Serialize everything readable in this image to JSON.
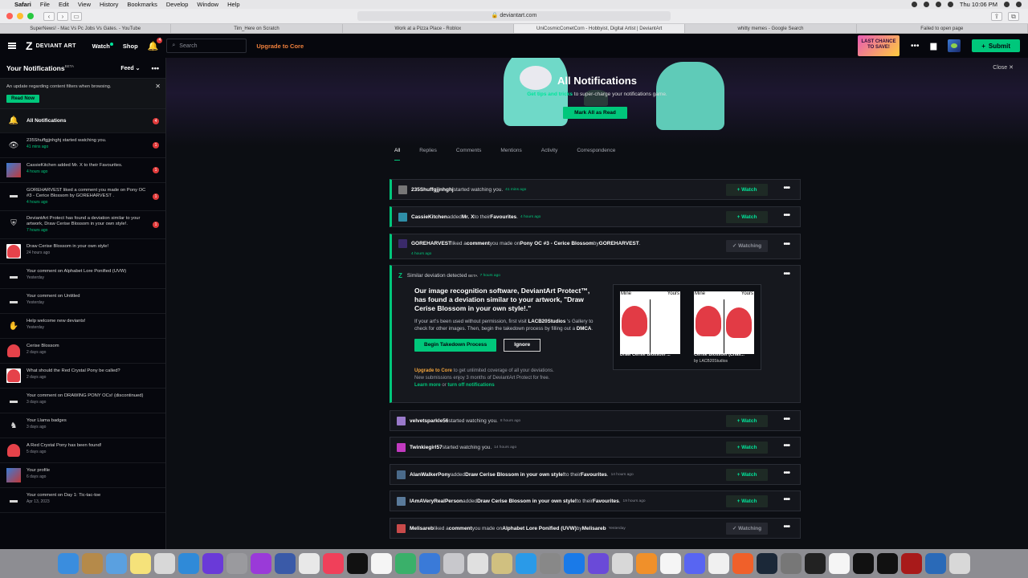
{
  "menubar": {
    "app": "Safari",
    "items": [
      "File",
      "Edit",
      "View",
      "History",
      "Bookmarks",
      "Develop",
      "Window",
      "Help"
    ],
    "clock": "Thu 10:06 PM"
  },
  "browser": {
    "url": "deviantart.com",
    "tabs": [
      "SuperNews! - Mac Vs Pc Jobs Vs Gates. - YouTube",
      "Tim_Here on Scratch",
      "Work at a Pizza Place - Roblox",
      "UniCosmicCometCorn - Hobbyist, Digital Artist | DeviantArt",
      "whitty memes - Google Search",
      "Failed to open page"
    ]
  },
  "header": {
    "logo": "DEVIANT ART",
    "watch": "Watch",
    "shop": "Shop",
    "bell_badge": "4",
    "search_placeholder": "Search",
    "upgrade": "Upgrade to Core",
    "promo": "LAST CHANCE TO SAVE!",
    "submit": "Submit"
  },
  "sidebar": {
    "title": "Your Notifications",
    "title_sup": "BETA",
    "feed": "Feed",
    "notice": "An update regarding content filters when browsing.",
    "notice_btn": "Read Now",
    "all_label": "All Notifications",
    "all_badge": "4",
    "items": [
      {
        "text": "235Shuffgjjnhghj started watching you.",
        "time": "41 mins ago",
        "badge": "1",
        "icon": "eye-icon",
        "green": true
      },
      {
        "text": "CassieKitchen added Mr. X to their Favourites.",
        "time": "4 hours ago",
        "badge": "1",
        "icon": "avatar",
        "green": true
      },
      {
        "text": "GOREHARVEST liked a comment you made on Pony OC #3 - Cerice Blossom by GOREHARVEST .",
        "time": "4 hours ago",
        "badge": "1",
        "icon": "comment-icon",
        "green": true
      },
      {
        "text": "DeviantArt Protect has found a deviation similar to your artwork, Draw Cerise Blossom in your own style!.",
        "time": "7 hours ago",
        "badge": "1",
        "icon": "shield-icon",
        "green": true
      },
      {
        "text": "Draw Cerise Blossom in your own style!",
        "time": "24 hours ago",
        "badge": "",
        "icon": "thumb",
        "green": false
      },
      {
        "text": "Your comment on Alphabet Lore Ponified (UVW)",
        "time": "Yesterday",
        "badge": "",
        "icon": "comment-icon",
        "green": false
      },
      {
        "text": "Your comment on Untitled",
        "time": "Yesterday",
        "badge": "",
        "icon": "comment-icon",
        "green": false
      },
      {
        "text": "Help welcome new deviants!",
        "time": "Yesterday",
        "badge": "",
        "icon": "wave-icon",
        "green": false
      },
      {
        "text": "Cerise Blossom",
        "time": "2 days ago",
        "badge": "",
        "icon": "pony",
        "green": false
      },
      {
        "text": "What should the Red Crystal Pony be called?",
        "time": "2 days ago",
        "badge": "",
        "icon": "thumb",
        "green": false
      },
      {
        "text": "Your comment on DRAWING PONY OCs! (discontinued)",
        "time": "3 days ago",
        "badge": "",
        "icon": "comment-icon",
        "green": false
      },
      {
        "text": "Your Llama badges",
        "time": "3 days ago",
        "badge": "",
        "icon": "llama-icon",
        "green": false
      },
      {
        "text": "A Red Crystal Pony has been found!",
        "time": "5 days ago",
        "badge": "",
        "icon": "pony",
        "green": false
      },
      {
        "text": "Your profile",
        "time": "6 days ago",
        "badge": "",
        "icon": "avatar",
        "green": false
      },
      {
        "text": "Your comment on Day 1: Tic-tac-toe",
        "time": "Apr 13, 2023",
        "badge": "",
        "icon": "comment-icon",
        "green": false
      }
    ]
  },
  "main": {
    "close": "Close",
    "title": "All Notifications",
    "sub_link": "Get tips and tricks",
    "sub_rest": " to super-charge your notifications game.",
    "mark_all": "Mark All as Read",
    "tabs": [
      "All",
      "Replies",
      "Comments",
      "Mentions",
      "Activity",
      "Correspondence"
    ],
    "cards": [
      {
        "user": "235Shuffgjjnhghj",
        "action": " started watching you.",
        "time": "41 mins ago",
        "btn": "+ Watch"
      },
      {
        "user": "CassieKitchen",
        "action": " added ",
        "obj": "Mr. X",
        "action2": " to their ",
        "obj2": "Favourites",
        "time": "4 hours ago",
        "btn": "+ Watch"
      },
      {
        "user": "GOREHARVEST",
        "action": " liked a ",
        "obj": "comment",
        "action2": " you made on ",
        "obj2": "Pony OC #3 - Cerice Blossom",
        "action3": " by ",
        "obj3": "GOREHARVEST",
        "time": "4 hours ago",
        "btn": "✓ Watching"
      }
    ],
    "protect": {
      "header": "Similar deviation detected",
      "sup": "BETA",
      "time": "7 hours ago",
      "headline": "Our image recognition software, DeviantArt Protect™, has found a deviation similar to your artwork, \"Draw Cerise Blossom in your own style!.\"",
      "desc1": "If your art's been used without permission, first visit ",
      "desc_user": "LACB20Studios",
      "desc2": " 's Gallery to check for other images. Then, begin the takedown process by filling out a ",
      "desc_dmca": "DMCA",
      "takedown": "Begin Takedown Process",
      "ignore": "Ignore",
      "up_link": "Upgrade to Core",
      "up_rest": " to get unlimited coverage of all your deviations.",
      "up_line2": "New submissions enjoy 3 months of DeviantArt Protect for free.",
      "learn": "Learn more",
      "or": " or ",
      "turnoff": "turn off notifications",
      "mine": "Mine",
      "yours": "Yours",
      "cap1": "Draw Cerise Blossom ...",
      "cap2": "Cerise Blossom (Chall...",
      "cap2_by": "by LACB20Studios"
    },
    "rows": [
      {
        "user": "velvetsparkle56",
        "text": " started watching you.",
        "time": "8 hours ago",
        "btn": "+ Watch"
      },
      {
        "user": "Twinkiegirl57",
        "text": " started watching you.",
        "time": "14 hours ago",
        "btn": "+ Watch"
      },
      {
        "user": "AlanWalkerPony",
        "text": " added ",
        "obj": "Draw Cerise Blossom in your own style!",
        "text2": " to their ",
        "obj2": "Favourites",
        "time": "14 hours ago",
        "btn": "+ Watch"
      },
      {
        "user": "IAmAVeryRealPerson",
        "text": " added ",
        "obj": "Draw Cerise Blossom in your own style!",
        "text2": " to their ",
        "obj2": "Favourites",
        "time": "19 hours ago",
        "btn": "+ Watch"
      },
      {
        "user": "Melisareb",
        "text": " liked a ",
        "obj": "comment",
        "text2": " you made on ",
        "obj2": "Alphabet Lore Ponified (UVW)",
        "text3": " by ",
        "obj3": "Melisareb",
        "time": "Yesterday",
        "btn": "✓ Watching"
      }
    ]
  },
  "colors": {
    "accent": "#00c77b",
    "badge": "#e03a3a",
    "upgrade": "#f0803c",
    "bg": "#06070d"
  }
}
